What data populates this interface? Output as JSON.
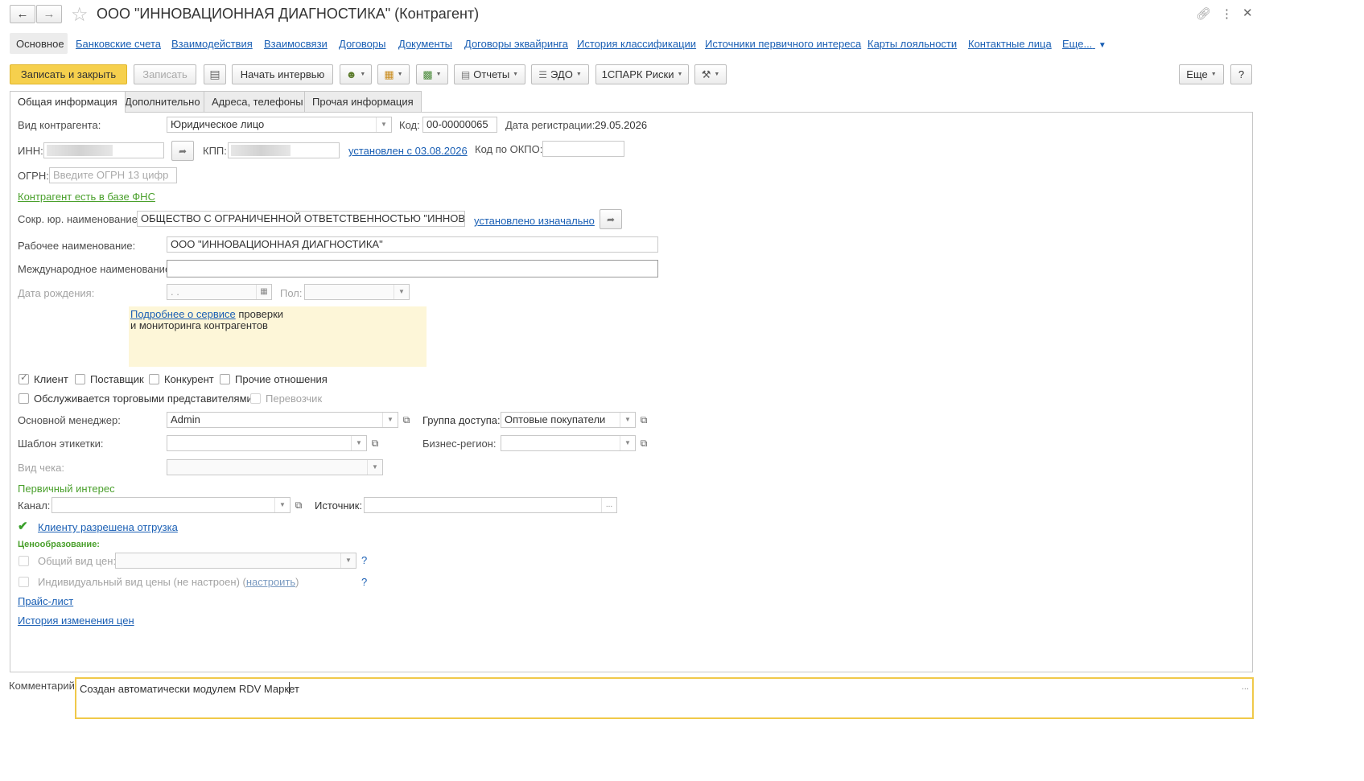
{
  "window": {
    "title": "ООО \"ИННОВАЦИОННАЯ ДИАГНОСТИКА\" (Контрагент)",
    "icons": [
      "back-arrow-icon",
      "forward-arrow-icon",
      "star-icon",
      "link-icon",
      "more-vertical-icon",
      "close-icon"
    ]
  },
  "nav": {
    "items": [
      "Основное",
      "Банковские счета",
      "Взаимодействия",
      "Взаимосвязи",
      "Договоры",
      "Документы",
      "Договоры эквайринга",
      "История классификации",
      "Источники первичного интереса",
      "Карты лояльности",
      "Контактные лица",
      "Еще..."
    ]
  },
  "toolbar": {
    "save_close": "Записать и закрыть",
    "save": "Записать",
    "interview": "Начать интервью",
    "reports": "Отчеты",
    "edo": "ЭДО",
    "spark": "1СПАРК Риски",
    "more": "Еще",
    "help": "?"
  },
  "tabs": [
    "Общая информация",
    "Дополнительно",
    "Адреса, телефоны",
    "Прочая информация"
  ],
  "form": {
    "kind_label": "Вид контрагента:",
    "kind_value": "Юридическое лицо",
    "code_label": "Код:",
    "code_value": "00-00000065",
    "reg_date_label": "Дата регистрации:",
    "reg_date_value": "29.05.2026",
    "inn_label": "ИНН:",
    "kpp_label": "КПП:",
    "kpp_link": "установлен с 03.08.2026",
    "okpo_label": "Код по ОКПО:",
    "ogrn_label": "ОГРН:",
    "ogrn_placeholder": "Введите ОГРН 13 цифр",
    "fns_link": "Контрагент есть в базе ФНС",
    "short_name_label": "Сокр. юр. наименование:",
    "short_name_value": "ОБЩЕСТВО С ОГРАНИЧЕННОЙ ОТВЕТСТВЕННОСТЬЮ \"ИННОВАЦИОН",
    "short_name_link": "установлено изначально",
    "work_name_label": "Рабочее наименование:",
    "work_name_value": "ООО \"ИННОВАЦИОННАЯ ДИАГНОСТИКА\"",
    "intl_name_label": "Международное наименование:",
    "birth_label": "Дата рождения:",
    "birth_value": " .  .",
    "gender_label": "Пол:",
    "service_link": "Подробнее о сервисе",
    "service_text1": " проверки",
    "service_text2": "и мониторинга контрагентов",
    "cb_client": "Клиент",
    "cb_supplier": "Поставщик",
    "cb_competitor": "Конкурент",
    "cb_other": "Прочие отношения",
    "cb_trade_reps": "Обслуживается торговыми представителями",
    "cb_carrier": "Перевозчик",
    "manager_label": "Основной менеджер:",
    "manager_value": "Admin",
    "access_group_label": "Группа доступа:",
    "access_group_value": "Оптовые покупатели",
    "label_template_label": "Шаблон этикетки:",
    "biz_region_label": "Бизнес-регион:",
    "receipt_kind_label": "Вид чека:",
    "primary_interest": "Первичный интерес",
    "channel_label": "Канал:",
    "source_label": "Источник:",
    "shipment_link": "Клиенту разрешена отгрузка",
    "pricing_label": "Ценообразование:",
    "common_price_label": "Общий вид цен:",
    "indiv_price_label": "Индивидуальный вид цены (не настроен) (",
    "indiv_price_link": "настроить",
    "indiv_price_close": ")",
    "qmark": "?",
    "pricelist_link": "Прайс-лист",
    "price_history_link": "История изменения цен",
    "comment_label": "Комментарий:",
    "comment_value": "Создан автоматически модулем RDV Маркет",
    "ellipsis": "..."
  },
  "colors": {
    "accent_yellow": "#f6d04d",
    "link_blue": "#1a5fb4",
    "green": "#4aa02c",
    "banner_bg": "#fdf6d8"
  }
}
